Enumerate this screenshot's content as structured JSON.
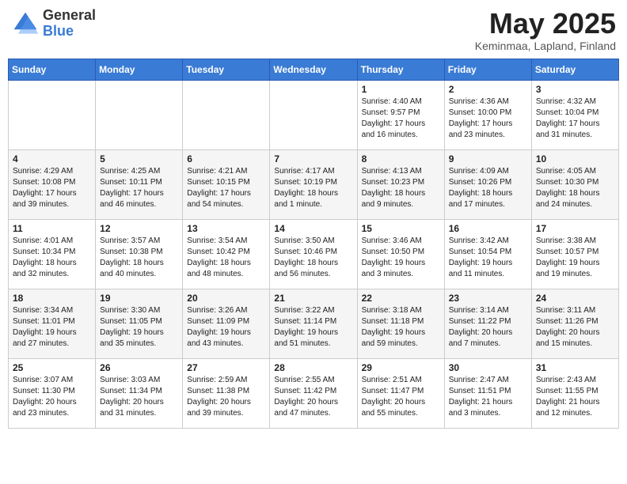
{
  "header": {
    "logo_general": "General",
    "logo_blue": "Blue",
    "title": "May 2025",
    "location": "Keminmaa, Lapland, Finland"
  },
  "weekdays": [
    "Sunday",
    "Monday",
    "Tuesday",
    "Wednesday",
    "Thursday",
    "Friday",
    "Saturday"
  ],
  "weeks": [
    [
      {
        "day": "",
        "info": ""
      },
      {
        "day": "",
        "info": ""
      },
      {
        "day": "",
        "info": ""
      },
      {
        "day": "",
        "info": ""
      },
      {
        "day": "1",
        "info": "Sunrise: 4:40 AM\nSunset: 9:57 PM\nDaylight: 17 hours\nand 16 minutes."
      },
      {
        "day": "2",
        "info": "Sunrise: 4:36 AM\nSunset: 10:00 PM\nDaylight: 17 hours\nand 23 minutes."
      },
      {
        "day": "3",
        "info": "Sunrise: 4:32 AM\nSunset: 10:04 PM\nDaylight: 17 hours\nand 31 minutes."
      }
    ],
    [
      {
        "day": "4",
        "info": "Sunrise: 4:29 AM\nSunset: 10:08 PM\nDaylight: 17 hours\nand 39 minutes."
      },
      {
        "day": "5",
        "info": "Sunrise: 4:25 AM\nSunset: 10:11 PM\nDaylight: 17 hours\nand 46 minutes."
      },
      {
        "day": "6",
        "info": "Sunrise: 4:21 AM\nSunset: 10:15 PM\nDaylight: 17 hours\nand 54 minutes."
      },
      {
        "day": "7",
        "info": "Sunrise: 4:17 AM\nSunset: 10:19 PM\nDaylight: 18 hours\nand 1 minute."
      },
      {
        "day": "8",
        "info": "Sunrise: 4:13 AM\nSunset: 10:23 PM\nDaylight: 18 hours\nand 9 minutes."
      },
      {
        "day": "9",
        "info": "Sunrise: 4:09 AM\nSunset: 10:26 PM\nDaylight: 18 hours\nand 17 minutes."
      },
      {
        "day": "10",
        "info": "Sunrise: 4:05 AM\nSunset: 10:30 PM\nDaylight: 18 hours\nand 24 minutes."
      }
    ],
    [
      {
        "day": "11",
        "info": "Sunrise: 4:01 AM\nSunset: 10:34 PM\nDaylight: 18 hours\nand 32 minutes."
      },
      {
        "day": "12",
        "info": "Sunrise: 3:57 AM\nSunset: 10:38 PM\nDaylight: 18 hours\nand 40 minutes."
      },
      {
        "day": "13",
        "info": "Sunrise: 3:54 AM\nSunset: 10:42 PM\nDaylight: 18 hours\nand 48 minutes."
      },
      {
        "day": "14",
        "info": "Sunrise: 3:50 AM\nSunset: 10:46 PM\nDaylight: 18 hours\nand 56 minutes."
      },
      {
        "day": "15",
        "info": "Sunrise: 3:46 AM\nSunset: 10:50 PM\nDaylight: 19 hours\nand 3 minutes."
      },
      {
        "day": "16",
        "info": "Sunrise: 3:42 AM\nSunset: 10:54 PM\nDaylight: 19 hours\nand 11 minutes."
      },
      {
        "day": "17",
        "info": "Sunrise: 3:38 AM\nSunset: 10:57 PM\nDaylight: 19 hours\nand 19 minutes."
      }
    ],
    [
      {
        "day": "18",
        "info": "Sunrise: 3:34 AM\nSunset: 11:01 PM\nDaylight: 19 hours\nand 27 minutes."
      },
      {
        "day": "19",
        "info": "Sunrise: 3:30 AM\nSunset: 11:05 PM\nDaylight: 19 hours\nand 35 minutes."
      },
      {
        "day": "20",
        "info": "Sunrise: 3:26 AM\nSunset: 11:09 PM\nDaylight: 19 hours\nand 43 minutes."
      },
      {
        "day": "21",
        "info": "Sunrise: 3:22 AM\nSunset: 11:14 PM\nDaylight: 19 hours\nand 51 minutes."
      },
      {
        "day": "22",
        "info": "Sunrise: 3:18 AM\nSunset: 11:18 PM\nDaylight: 19 hours\nand 59 minutes."
      },
      {
        "day": "23",
        "info": "Sunrise: 3:14 AM\nSunset: 11:22 PM\nDaylight: 20 hours\nand 7 minutes."
      },
      {
        "day": "24",
        "info": "Sunrise: 3:11 AM\nSunset: 11:26 PM\nDaylight: 20 hours\nand 15 minutes."
      }
    ],
    [
      {
        "day": "25",
        "info": "Sunrise: 3:07 AM\nSunset: 11:30 PM\nDaylight: 20 hours\nand 23 minutes."
      },
      {
        "day": "26",
        "info": "Sunrise: 3:03 AM\nSunset: 11:34 PM\nDaylight: 20 hours\nand 31 minutes."
      },
      {
        "day": "27",
        "info": "Sunrise: 2:59 AM\nSunset: 11:38 PM\nDaylight: 20 hours\nand 39 minutes."
      },
      {
        "day": "28",
        "info": "Sunrise: 2:55 AM\nSunset: 11:42 PM\nDaylight: 20 hours\nand 47 minutes."
      },
      {
        "day": "29",
        "info": "Sunrise: 2:51 AM\nSunset: 11:47 PM\nDaylight: 20 hours\nand 55 minutes."
      },
      {
        "day": "30",
        "info": "Sunrise: 2:47 AM\nSunset: 11:51 PM\nDaylight: 21 hours\nand 3 minutes."
      },
      {
        "day": "31",
        "info": "Sunrise: 2:43 AM\nSunset: 11:55 PM\nDaylight: 21 hours\nand 12 minutes."
      }
    ]
  ]
}
